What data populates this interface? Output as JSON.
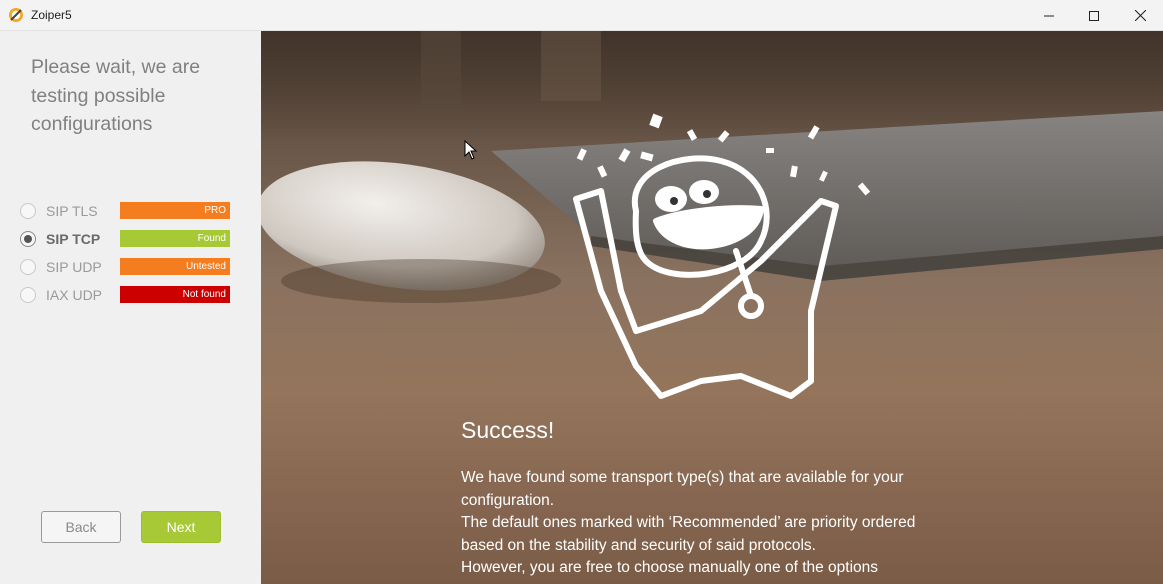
{
  "window": {
    "title": "Zoiper5"
  },
  "sidebar": {
    "heading": " Please wait, we are\ntesting possible\nconfigurations",
    "options": [
      {
        "label": "SIP TLS",
        "status": "PRO",
        "status_color": "#f47d20",
        "checked": false
      },
      {
        "label": "SIP TCP",
        "status": "Found",
        "status_color": "#a6c935",
        "checked": true
      },
      {
        "label": "SIP UDP",
        "status": "Untested",
        "status_color": "#f47d20",
        "checked": false
      },
      {
        "label": "IAX UDP",
        "status": "Not found",
        "status_color": "#cc0000",
        "checked": false
      }
    ],
    "back_label": "Back",
    "next_label": "Next"
  },
  "main": {
    "success_title": "Success!",
    "desc_line1": " We have found some transport type(s) that are available for your configuration.",
    "desc_line2": "The default ones marked with ‘Recommended’ are priority ordered based on the stability and security of said protocols.",
    "desc_line3": "However, you are free to choose manually one of the options"
  },
  "colors": {
    "accent": "#a6c935",
    "warning": "#f47d20",
    "error": "#cc0000"
  }
}
